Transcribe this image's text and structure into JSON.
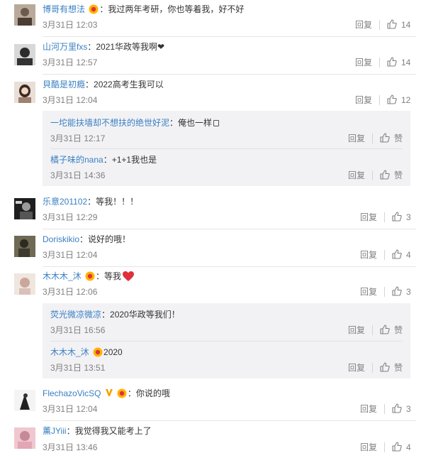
{
  "comments": [
    {
      "user": "博哥有想法",
      "text": "我过两年考研，你也等着我，好不好",
      "time": "3月31日 12:03",
      "reply": "回复",
      "likes": "14"
    },
    {
      "user": "山河万里fxs",
      "text": "2021华政等我啊❤",
      "time": "3月31日 12:57",
      "reply": "回复",
      "likes": "14"
    },
    {
      "user": "貝酷是初瘾",
      "text": "2022高考生我可以",
      "time": "3月31日 12:04",
      "reply": "回复",
      "likes": "12",
      "replies": [
        {
          "user": "一坨能扶墙却不想扶的绝世好泥",
          "text": "俺也一样",
          "time": "3月31日 12:17",
          "reply": "回复",
          "like": "赞"
        },
        {
          "user": "橘子味的nana",
          "text": "+1+1我也是",
          "time": "3月31日 14:36",
          "reply": "回复",
          "like": "赞"
        }
      ]
    },
    {
      "user": "乐意201102",
      "text": "等我！！！",
      "time": "3月31日 12:29",
      "reply": "回复",
      "likes": "3"
    },
    {
      "user": "Doriskikio",
      "text": "说好的哦！",
      "time": "3月31日 12:04",
      "reply": "回复",
      "likes": "4"
    },
    {
      "user": "木木木_沐",
      "text": "等我",
      "time": "3月31日 12:06",
      "reply": "回复",
      "likes": "3",
      "replies": [
        {
          "user": "荧光微凉微凉",
          "text": "2020华政等我们！",
          "time": "3月31日 16:56",
          "reply": "回复",
          "like": "赞"
        },
        {
          "user": "木木木_沐",
          "text": "2020",
          "time": "3月31日 13:51",
          "reply": "回复",
          "like": "赞"
        }
      ]
    },
    {
      "user": "FlechazoVicSQ",
      "text": "你说的哦",
      "time": "3月31日 12:04",
      "reply": "回复",
      "likes": "3"
    },
    {
      "user": "薰JYiii",
      "text": "我觉得我又能考上了",
      "time": "3月31日 13:46",
      "reply": "回复",
      "likes": "4"
    }
  ],
  "colors": {
    "username": "#3a7fc1",
    "meta": "#808080",
    "reply_bg": "#f2f2f5",
    "heart": "#e0303a"
  }
}
